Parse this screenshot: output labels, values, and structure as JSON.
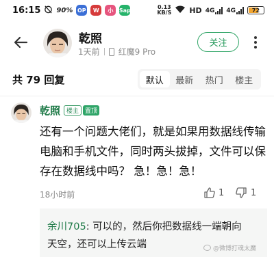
{
  "status_bar": {
    "time": "16:15",
    "speed": "90",
    "speed_unit": "%",
    "net_speed_value": "0.13",
    "net_speed_unit": "KB/S",
    "hd": "HD",
    "sig1_type": "4G",
    "sig2_type": "4G",
    "battery_level": "72",
    "battery_fraction": 0.72,
    "app_icons": [
      {
        "name": "app-icon-1",
        "color": "#3b6fd6",
        "text": "OP"
      },
      {
        "name": "app-icon-2",
        "color": "#d63b3b",
        "text": "W"
      },
      {
        "name": "app-icon-3",
        "color": "#e6557e",
        "text": "小"
      },
      {
        "name": "app-icon-4",
        "color": "#26b36a",
        "text": "Sap"
      }
    ]
  },
  "nav": {
    "user_name": "乾照",
    "post_time": "1天前",
    "device": "红魔9 Pro",
    "follow_label": "关注"
  },
  "replies_header": {
    "count_label": "共 79 回复",
    "sort_tabs": [
      "默认",
      "最新",
      "热门",
      "楼主"
    ],
    "active_tab": "默认"
  },
  "comment": {
    "author": "乾照",
    "badge_owner": "楼主",
    "badge_pinned": "置顶",
    "body_lines": [
      "还有一个问题大佬们，就是如果用数据线传输",
      "电脑和手机文件，同时两头拔掉，文件可以保",
      "存在数据线中吗？ 急！急！急！"
    ],
    "time": "18小时前",
    "like_count": "1",
    "dislike_count": "1"
  },
  "sub_reply": {
    "author": "余川705",
    "text_line1": ": 可以的，然后你把数据线一端朝向",
    "text_line2": "天空，还可以上传云端"
  },
  "watermark": "@微博打魂太魔",
  "colors": {
    "accent_green": "#2fa568",
    "name_green": "#1e7a47",
    "battery": "#f2a530"
  }
}
